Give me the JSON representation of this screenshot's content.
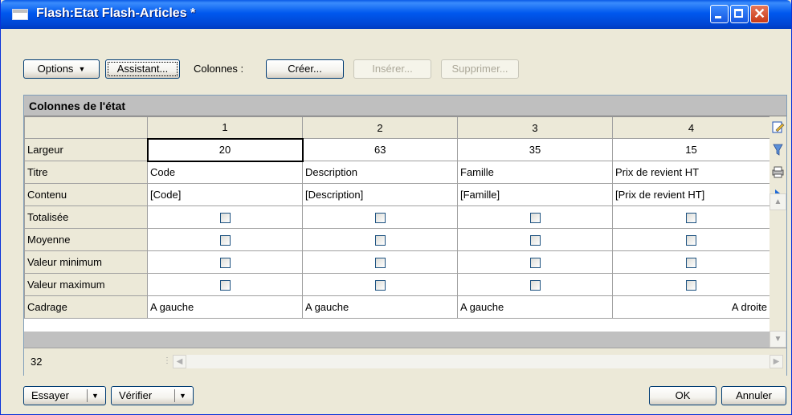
{
  "window": {
    "title": "Flash:Etat Flash-Articles *"
  },
  "toolbar": {
    "options_label": "Options",
    "assistant_label": "Assistant...",
    "colonnes_label": "Colonnes :",
    "creer_label": "Créer...",
    "inserer_label": "Insérer...",
    "supprimer_label": "Supprimer..."
  },
  "panel": {
    "title": "Colonnes de l'état"
  },
  "grid": {
    "columns": [
      "1",
      "2",
      "3",
      "4"
    ],
    "rows": {
      "largeur": {
        "label": "Largeur",
        "values": [
          "20",
          "63",
          "35",
          "15"
        ]
      },
      "titre": {
        "label": "Titre",
        "values": [
          "Code",
          "Description",
          "Famille",
          "Prix de revient HT"
        ]
      },
      "contenu": {
        "label": "Contenu",
        "values": [
          "[Code]",
          "[Description]",
          "[Famille]",
          "[Prix de revient HT]"
        ]
      },
      "totalisee": {
        "label": "Totalisée"
      },
      "moyenne": {
        "label": "Moyenne"
      },
      "valeur_min": {
        "label": "Valeur minimum"
      },
      "valeur_max": {
        "label": "Valeur maximum"
      },
      "cadrage": {
        "label": "Cadrage",
        "values": [
          "A gauche",
          "A gauche",
          "A gauche",
          "A droite"
        ]
      }
    }
  },
  "status": {
    "count": "32"
  },
  "footer": {
    "essayer_label": "Essayer",
    "verifier_label": "Vérifier",
    "ok_label": "OK",
    "annuler_label": "Annuler"
  },
  "colors": {
    "title_bar": "#0058ee",
    "dialog_bg": "#ece9d8",
    "close_button": "#c93a17"
  }
}
